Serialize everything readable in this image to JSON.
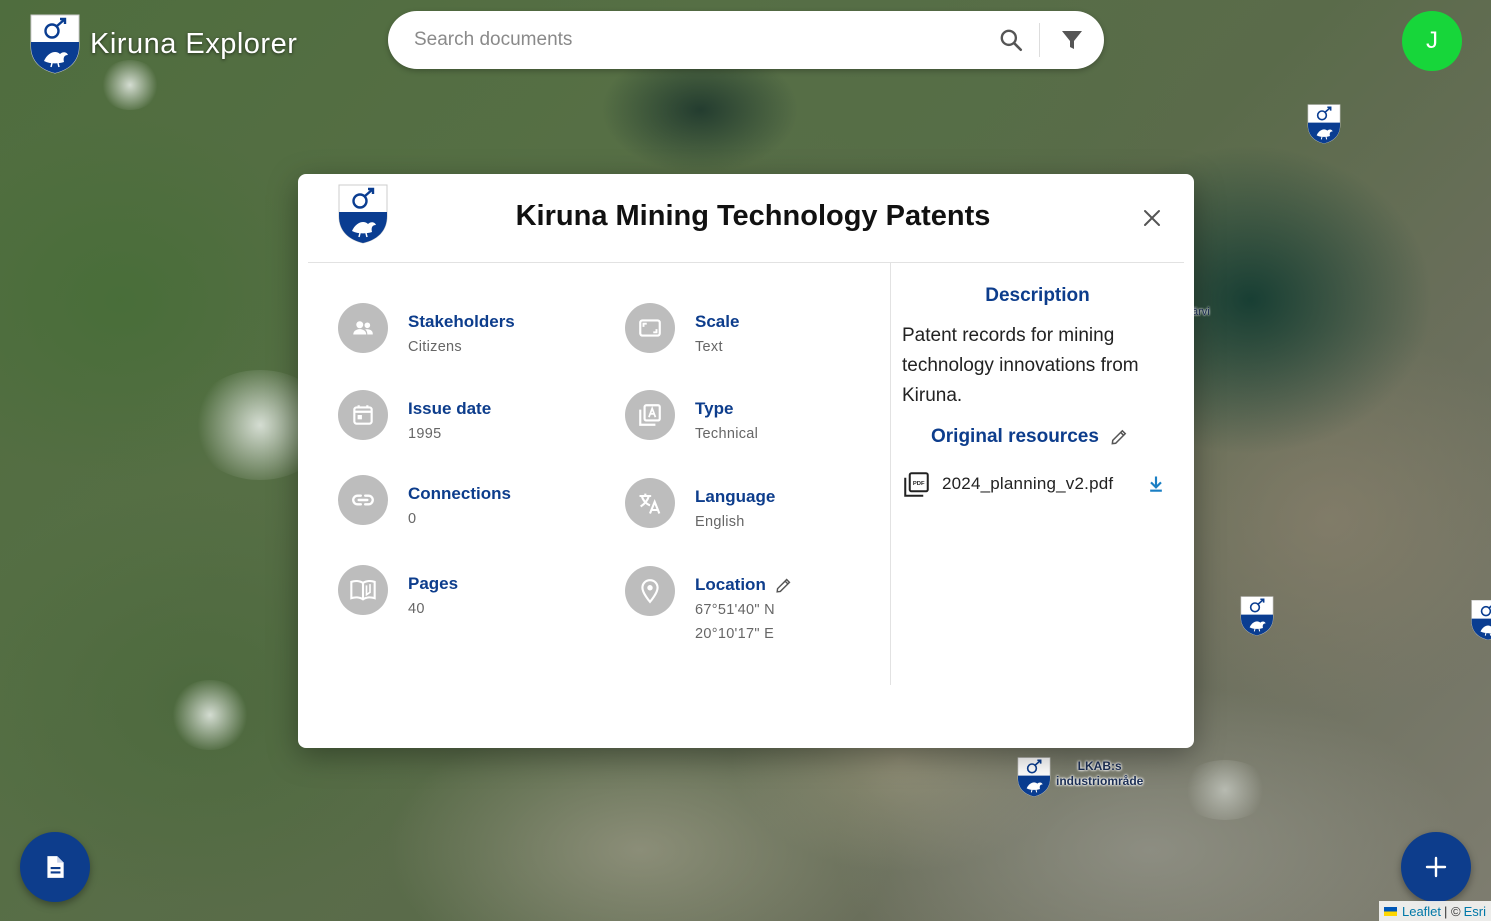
{
  "app": {
    "title": "Kiruna Explorer",
    "user_initial": "J"
  },
  "search": {
    "placeholder": "Search documents"
  },
  "map": {
    "label_industrial_line1": "LKAB:s",
    "label_industrial_line2": "industriområde",
    "label_lake_fragment": "ärvi",
    "attribution_provider": "Leaflet",
    "attribution_separator": "| ©",
    "attribution_tiles": "Esri"
  },
  "document": {
    "title": "Kiruna Mining Technology Patents",
    "fields": {
      "stakeholders": {
        "label": "Stakeholders",
        "value": "Citizens"
      },
      "scale": {
        "label": "Scale",
        "value": "Text"
      },
      "issue_date": {
        "label": "Issue date",
        "value": "1995"
      },
      "type": {
        "label": "Type",
        "value": "Technical"
      },
      "connections": {
        "label": "Connections",
        "value": "0"
      },
      "language": {
        "label": "Language",
        "value": "English"
      },
      "pages": {
        "label": "Pages",
        "value": "40"
      },
      "location": {
        "label": "Location",
        "latitude": "67°51'40\" N",
        "longitude": "20°10'17\" E"
      }
    },
    "description_title": "Description",
    "description": "Patent records for mining technology innovations from Kiruna.",
    "resources_title": "Original resources",
    "resources": [
      {
        "name": "2024_planning_v2.pdf"
      }
    ]
  },
  "theme": {
    "primary": "#0d3d8c",
    "avatar_bg": "#17d63a",
    "icon_circle": "#bdbdbd"
  }
}
